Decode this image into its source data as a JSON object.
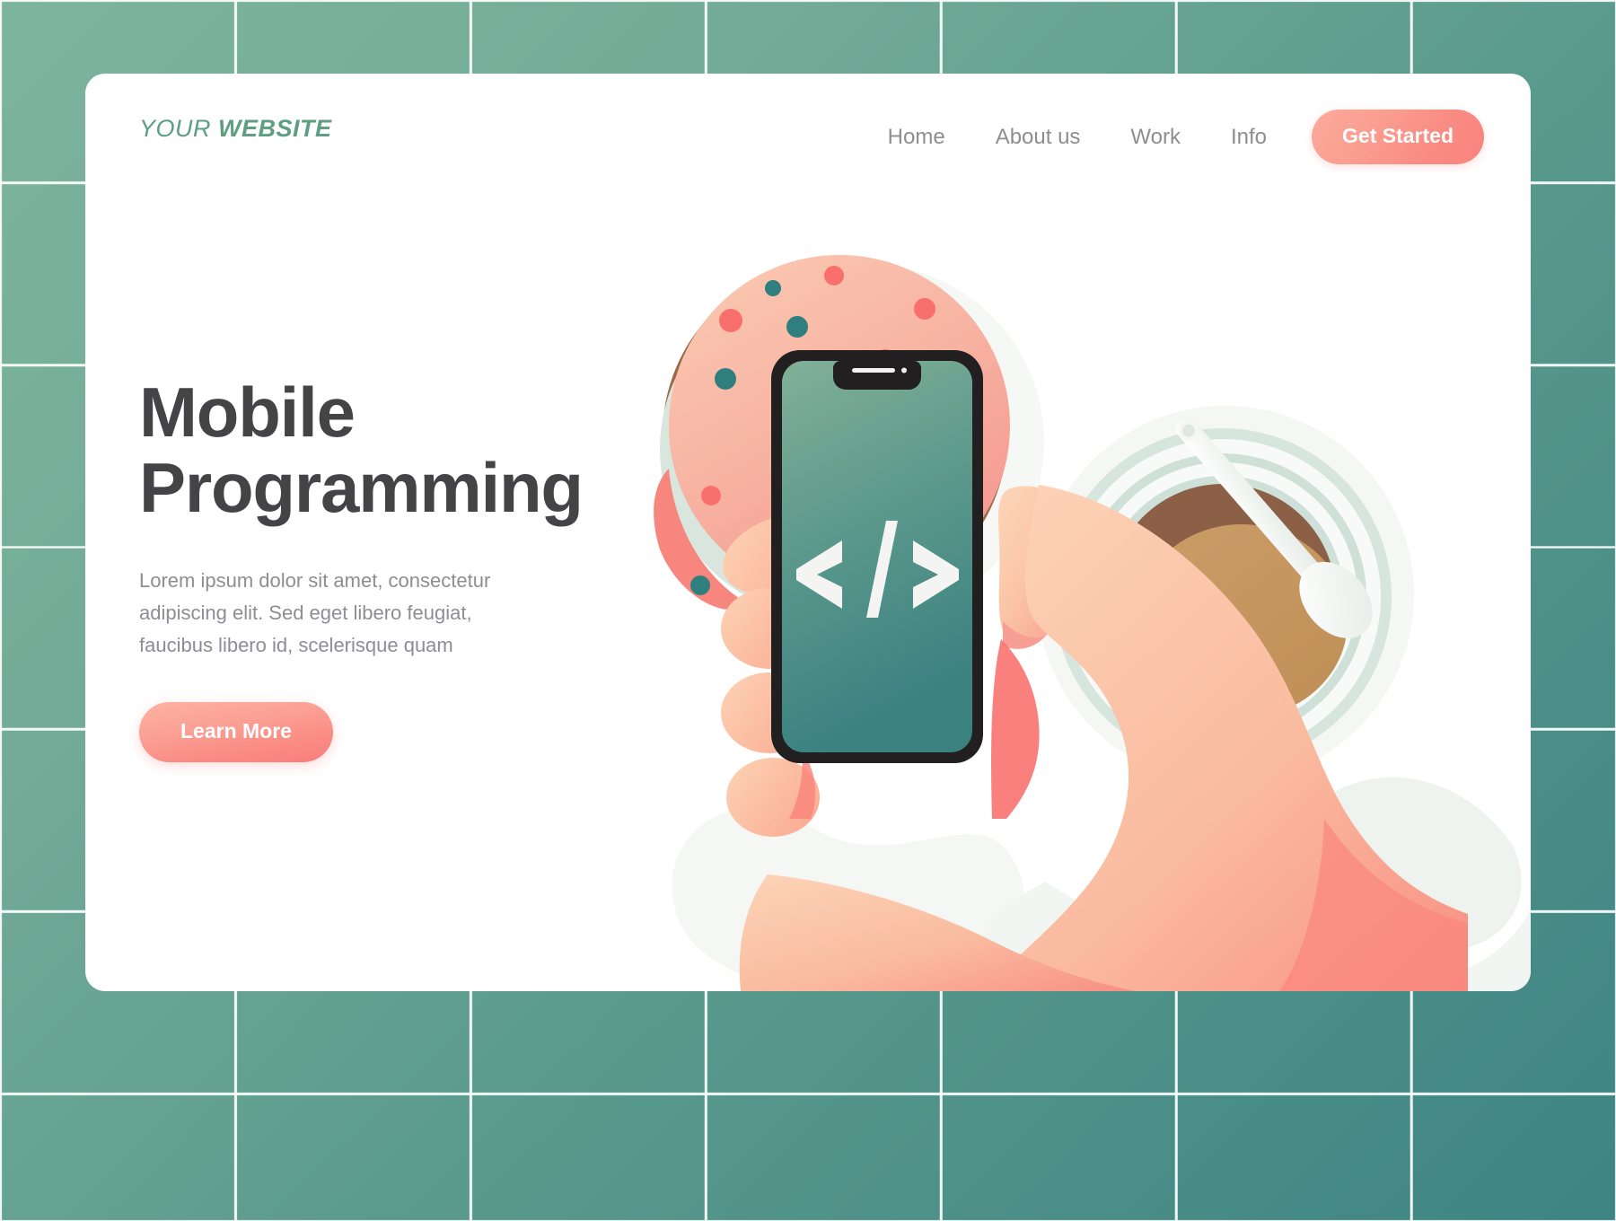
{
  "background": {
    "tile_color_light": "#7cb49f",
    "tile_color_dark": "#3d8483",
    "grid_line_color": "#ffffff"
  },
  "card": {
    "background": "#ffffff",
    "corner_radius": "22px"
  },
  "header": {
    "logo": {
      "light_word": "YOUR",
      "bold_word": "WEBSITE",
      "color": "#5e9e82"
    },
    "nav_links": [
      {
        "label": "Home"
      },
      {
        "label": "About us"
      },
      {
        "label": "Work"
      },
      {
        "label": "Info"
      }
    ],
    "cta": {
      "label": "Get Started",
      "color_start": "#fbaa9b",
      "color_end": "#f9837f",
      "text_color": "#ffffff"
    },
    "nav_text_color": "#8d8d94"
  },
  "hero": {
    "title_line1": "Mobile",
    "title_line2": "Programming",
    "title_color": "#444446",
    "paragraph": "Lorem ipsum dolor sit amet, consectetur adipiscing elit. Sed eget libero feugiat, faucibus libero id, scelerisque quam",
    "paragraph_color": "#8d8d94",
    "button": {
      "label": "Learn More",
      "color_start": "#fcb3a3",
      "color_end": "#f97e7c",
      "text_color": "#ffffff"
    }
  },
  "illustration": {
    "name": "hand-holding-phone-with-donut-and-coffee",
    "phone": {
      "frame_color": "#211f20",
      "screen_color_top": "#7aab96",
      "screen_color_bottom": "#3d8380",
      "screen_glyph": "</>",
      "glyph_color": "#f4f5f2",
      "notch_color": "#211f20"
    },
    "donut": {
      "frosting_color_light": "#f9c3ad",
      "frosting_color_dark": "#f79e96",
      "dough_color": "#9b6a46",
      "hole_color": "#d4e2da",
      "sprinkle_colors": [
        "#f86f6b",
        "#2f7f7f"
      ]
    },
    "coffee": {
      "saucer_color": "#f4f6f4",
      "rim_color": "#cfe0d8",
      "coffee_dark": "#8b6046",
      "coffee_light": "#c79760",
      "spoon_color": "#f1f4f2"
    },
    "hand": {
      "skin_light": "#fbceb2",
      "skin_mid": "#fab9a0",
      "skin_shadow": "#f97e7c"
    }
  }
}
